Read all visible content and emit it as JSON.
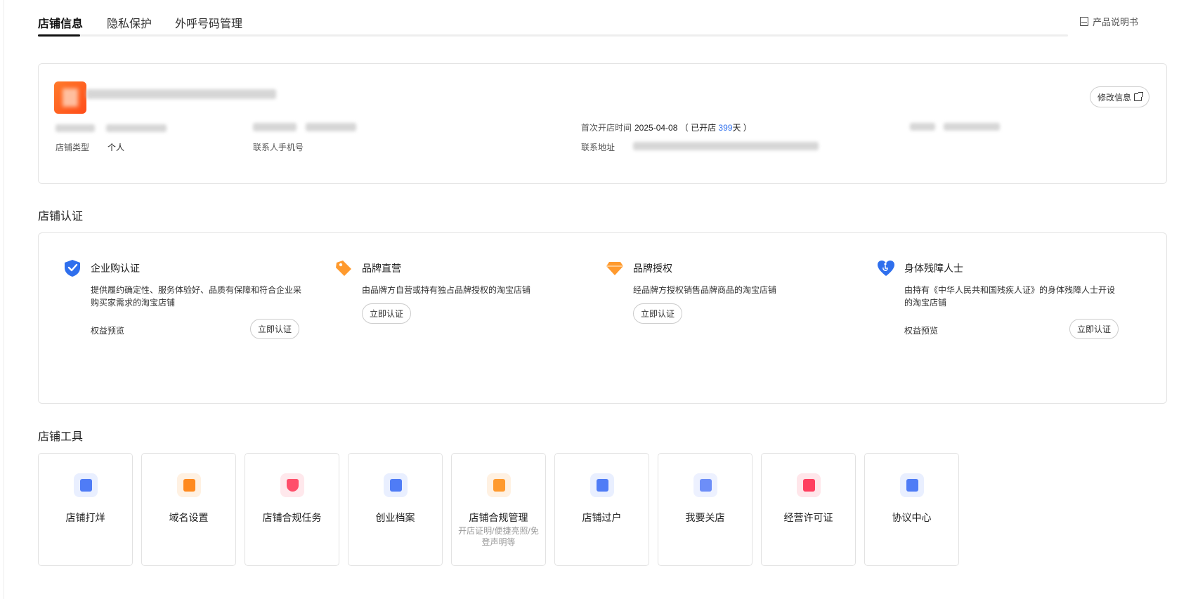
{
  "tabs": [
    {
      "label": "店铺信息",
      "active": true
    },
    {
      "label": "隐私保护",
      "active": false
    },
    {
      "label": "外呼号码管理",
      "active": false
    }
  ],
  "header": {
    "manual_label": "产品说明书",
    "manual_icon": "book-icon"
  },
  "shop_info": {
    "edit_label": "修改信息",
    "shop_type_label": "店铺类型",
    "shop_type_value": "个人",
    "contact_phone_label": "联系人手机号",
    "first_open_label": "首次开店时间",
    "first_open_date": "2025-04-08",
    "open_days_prefix": "（ 已开店 ",
    "open_days": "399",
    "open_days_suffix": "天 ）",
    "address_label": "联系地址"
  },
  "certification": {
    "section_title": "店铺认证",
    "items": [
      {
        "title": "企业购认证",
        "icon": "shield-check-icon",
        "desc": "提供履约确定性、服务体验好、品质有保障和符合企业采购买家需求的淘宝店铺",
        "benefit": "权益预览",
        "button": "立即认证"
      },
      {
        "title": "品牌直营",
        "icon": "tag-icon",
        "desc": "由品牌方自营或持有独占品牌授权的淘宝店铺",
        "button": "立即认证"
      },
      {
        "title": "品牌授权",
        "icon": "diamond-icon",
        "desc": "经品牌方授权销售品牌商品的淘宝店铺",
        "button": "立即认证"
      },
      {
        "title": "身体残障人士",
        "icon": "accessibility-heart-icon",
        "desc": "由持有《中华人民共和国残疾人证》的身体残障人士开设的淘宝店铺",
        "benefit": "权益预览",
        "button": "立即认证"
      }
    ]
  },
  "tools": {
    "section_title": "店铺工具",
    "items": [
      {
        "label": "店铺打烊",
        "icon": "shop-close-icon",
        "color": "#4f7cf6"
      },
      {
        "label": "域名设置",
        "icon": "domain-settings-icon",
        "color": "#ff8a1f"
      },
      {
        "label": "店铺合规任务",
        "icon": "compliance-shield-icon",
        "color": "#ff4f6b"
      },
      {
        "label": "创业档案",
        "icon": "archive-icon",
        "color": "#4f7cf6"
      },
      {
        "label": "店铺合规管理",
        "sub": "开店证明/便捷亮照/免登声明等",
        "icon": "compliance-doc-icon",
        "color": "#ff9a2e"
      },
      {
        "label": "店铺过户",
        "icon": "transfer-icon",
        "color": "#4f7cf6"
      },
      {
        "label": "我要关店",
        "icon": "close-shop-icon",
        "color": "#6d8ef8"
      },
      {
        "label": "经营许可证",
        "icon": "license-folder-icon",
        "color": "#ff3f5f"
      },
      {
        "label": "协议中心",
        "icon": "agreement-icon",
        "color": "#4f7cf6"
      }
    ]
  }
}
